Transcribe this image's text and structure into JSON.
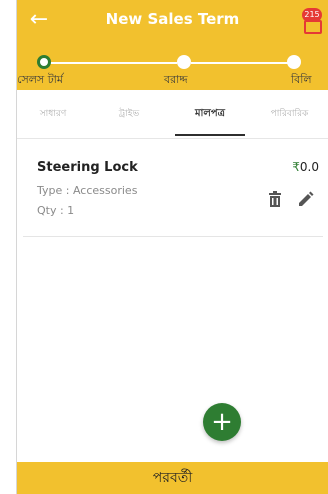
{
  "header": {
    "title": "New Sales Term",
    "cart_badge": "215"
  },
  "stepper": {
    "steps": [
      {
        "label": "সেলস টার্ম"
      },
      {
        "label": "বরাদ্দ"
      },
      {
        "label": "বিলি"
      }
    ]
  },
  "tabs": [
    {
      "label": "সাধারণ"
    },
    {
      "label": "ট্রাইভ"
    },
    {
      "label": "মালপত্র"
    },
    {
      "label": "পারিবারিক"
    }
  ],
  "item": {
    "name": "Steering Lock",
    "price": "0.0",
    "currency": "₹",
    "type": "Type : Accessories",
    "qty": "Qty : 1"
  },
  "footer": {
    "next_label": "পরবর্তী"
  },
  "colors": {
    "accent": "#f2c12e",
    "active": "#2e7d32",
    "badge": "#e53935"
  },
  "icons": [
    "back-arrow-icon",
    "cart-icon",
    "trash-icon",
    "pencil-icon",
    "plus-icon"
  ]
}
